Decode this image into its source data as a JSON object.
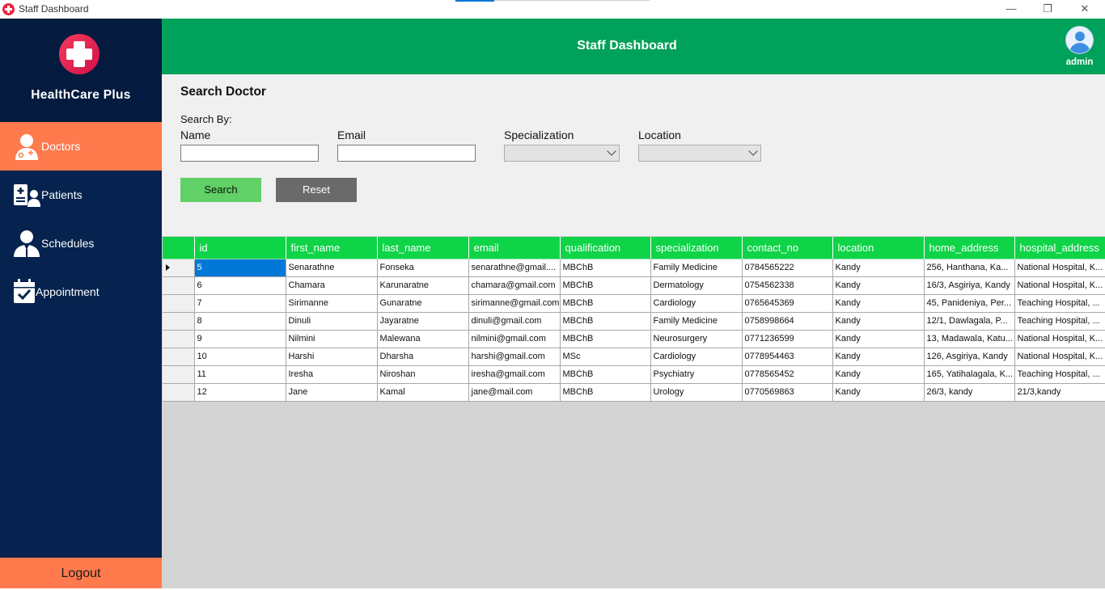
{
  "window": {
    "title": "Staff Dashboard",
    "controls": {
      "minimize": "—",
      "maximize": "❐",
      "close": "✕"
    }
  },
  "sidebar": {
    "brand": "HealthCare Plus",
    "items": [
      {
        "label": "Doctors",
        "icon": "doctor-icon",
        "active": true
      },
      {
        "label": "Patients",
        "icon": "patients-icon",
        "active": false
      },
      {
        "label": "Schedules",
        "icon": "schedules-icon",
        "active": false
      },
      {
        "label": "Appointment",
        "icon": "calendar-check-icon",
        "active": false
      }
    ],
    "logout": "Logout"
  },
  "header": {
    "title": "Staff Dashboard",
    "user": "admin"
  },
  "search": {
    "title": "Search Doctor",
    "search_by": "Search By:",
    "name_label": "Name",
    "email_label": "Email",
    "specialization_label": "Specialization",
    "location_label": "Location",
    "name_value": "",
    "email_value": "",
    "specialization_value": "",
    "location_value": "",
    "search_button": "Search",
    "reset_button": "Reset"
  },
  "grid": {
    "columns": [
      "id",
      "first_name",
      "last_name",
      "email",
      "qualification",
      "specialization",
      "contact_no",
      "location",
      "home_address",
      "hospital_address"
    ],
    "rows": [
      [
        "5",
        "Senarathne",
        "Fonseka",
        "senarathne@gmail....",
        "MBChB",
        "Family Medicine",
        "0784565222",
        "Kandy",
        "256, Hanthana, Ka...",
        "National Hospital, K..."
      ],
      [
        "6",
        "Chamara",
        "Karunaratne",
        "chamara@gmail.com",
        "MBChB",
        "Dermatology",
        "0754562338",
        "Kandy",
        "16/3, Asgiriya, Kandy",
        "National Hospital, K..."
      ],
      [
        "7",
        "Sirimanne",
        "Gunaratne",
        "sirimanne@gmail.com",
        "MBChB",
        "Cardiology",
        "0765645369",
        "Kandy",
        "45, Panideniya, Per...",
        "Teaching Hospital, ..."
      ],
      [
        "8",
        "Dinuli",
        "Jayaratne",
        "dinuli@gmail.com",
        "MBChB",
        "Family Medicine",
        "0758998664",
        "Kandy",
        "12/1, Dawlagala, P...",
        "Teaching Hospital, ..."
      ],
      [
        "9",
        "Nilmini",
        "Malewana",
        "nilmini@gmail.com",
        "MBChB",
        "Neurosurgery",
        "0771236599",
        "Kandy",
        "13, Madawala, Katu...",
        "National Hospital, K..."
      ],
      [
        "10",
        "Harshi",
        "Dharsha",
        "harshi@gmail.com",
        "MSc",
        "Cardiology",
        "0778954463",
        "Kandy",
        "126, Asgiriya, Kandy",
        "National Hospital, K..."
      ],
      [
        "11",
        "Iresha",
        "Niroshan",
        "iresha@gmail.com",
        "MBChB",
        "Psychiatry",
        "0778565452",
        "Kandy",
        "165, Yatihalagala, K...",
        "Teaching Hospital, ..."
      ],
      [
        "12",
        "Jane",
        "Kamal",
        "jane@mail.com",
        "MBChB",
        "Urology",
        "0770569863",
        "Kandy",
        "26/3, kandy",
        "21/3,kandy"
      ]
    ]
  },
  "colors": {
    "sidebar": "#05234e",
    "accent": "#ff7a4d",
    "header": "#00a15a",
    "grid_header": "#0fd448",
    "search_button": "#61d066",
    "reset_button": "#6a6a6a",
    "selection": "#0078d7"
  }
}
